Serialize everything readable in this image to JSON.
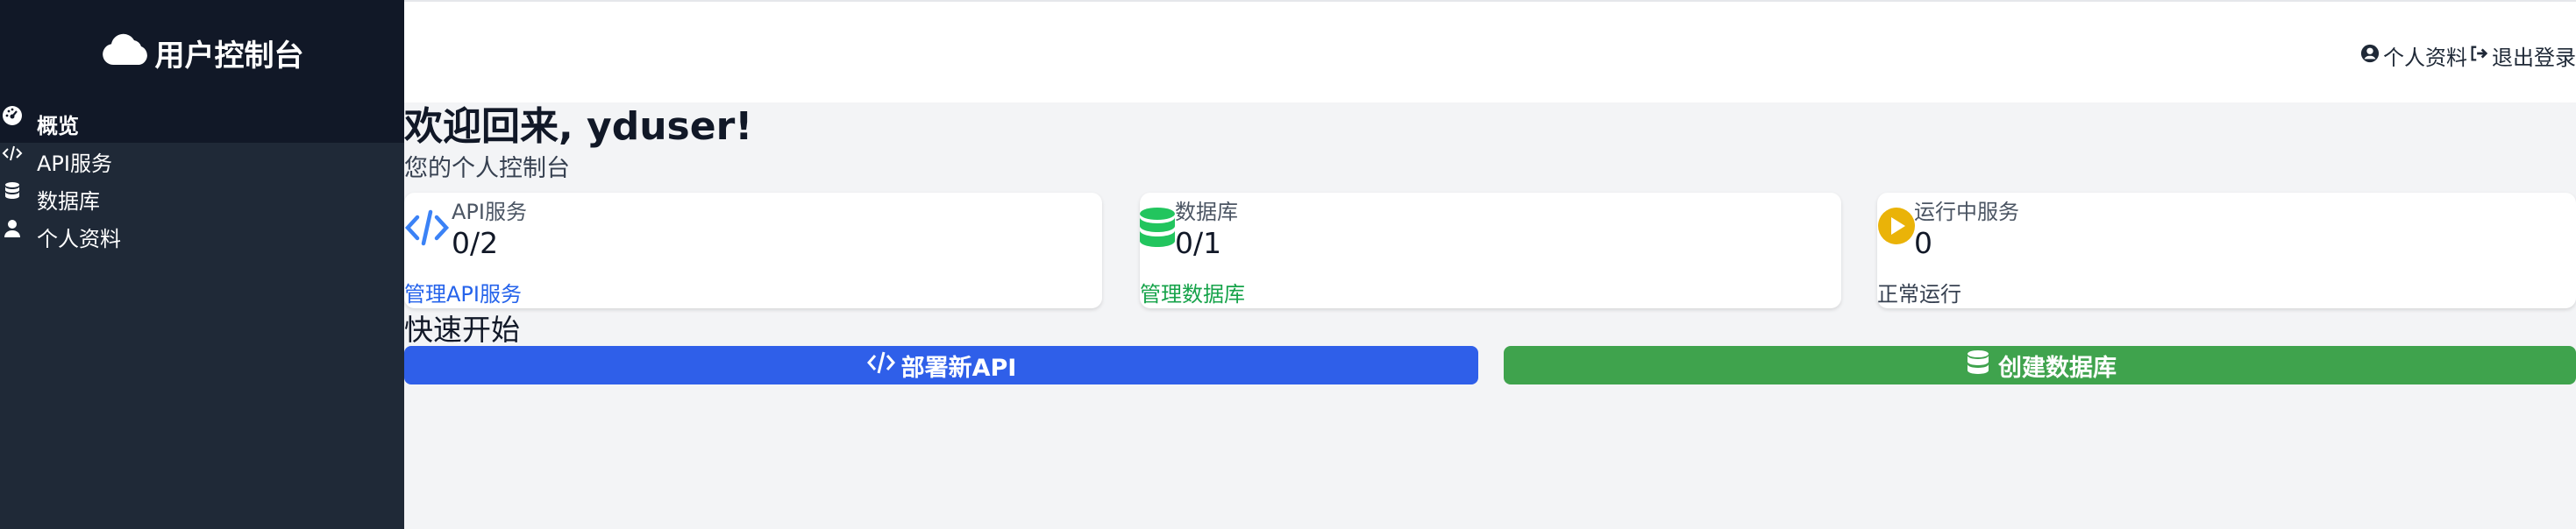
{
  "brand": {
    "title": "用户控制台",
    "icon": "cloud-icon"
  },
  "sidebar": {
    "items": [
      {
        "label": "概览",
        "icon": "dashboard-icon",
        "active": true
      },
      {
        "label": "API服务",
        "icon": "code-icon",
        "active": false
      },
      {
        "label": "数据库",
        "icon": "database-icon",
        "active": false
      },
      {
        "label": "个人资料",
        "icon": "user-icon",
        "active": false
      }
    ]
  },
  "header": {
    "profile_label": "个人资料",
    "logout_label": "退出登录"
  },
  "main": {
    "welcome": "欢迎回来, yduser!",
    "subtitle": "您的个人控制台",
    "cards": [
      {
        "label": "API服务",
        "value": "0/2",
        "link": "管理API服务",
        "color": "#3b82f6"
      },
      {
        "label": "数据库",
        "value": "0/1",
        "link": "管理数据库",
        "color": "#22c55e"
      },
      {
        "label": "运行中服务",
        "value": "0",
        "link": "正常运行",
        "color": "#eab308"
      }
    ],
    "quick_start": {
      "title": "快速开始",
      "deploy_label": "部署新API",
      "create_db_label": "创建数据库"
    }
  },
  "colors": {
    "sidebar_bg": "#1f2937",
    "sidebar_active": "#111827",
    "primary": "#2f5fe9",
    "success": "#3fa34d"
  }
}
